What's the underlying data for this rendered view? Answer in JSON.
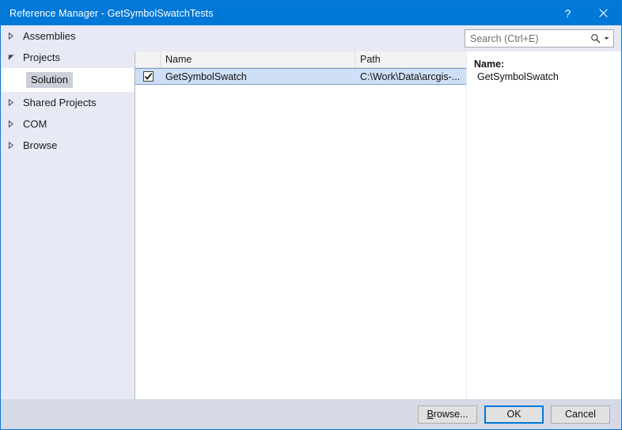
{
  "window": {
    "title": "Reference Manager - GetSymbolSwatchTests",
    "help_button": "?",
    "close_button": "✕",
    "accent_color": "#0078d7",
    "border_color": "#0d7ad4",
    "sidebar_bg": "#e7eaf4",
    "footer_bg": "#d6dae7",
    "selection_bg": "#cfdff7"
  },
  "sidebar": {
    "items": [
      {
        "label": "Assemblies",
        "expanded": false,
        "icon": "chevron-right-icon"
      },
      {
        "label": "Projects",
        "expanded": true,
        "icon": "chevron-down-icon"
      },
      {
        "label": "Shared Projects",
        "expanded": false,
        "icon": "chevron-right-icon"
      },
      {
        "label": "COM",
        "expanded": false,
        "icon": "chevron-right-icon"
      },
      {
        "label": "Browse",
        "expanded": false,
        "icon": "chevron-right-icon"
      }
    ],
    "child": {
      "label": "Solution",
      "selected": true
    }
  },
  "search": {
    "placeholder": "Search (Ctrl+E)",
    "value": "",
    "icon": "search-icon",
    "dropdown_icon": "chevron-down-icon"
  },
  "list": {
    "columns": [
      {
        "key": "check",
        "label": ""
      },
      {
        "key": "name",
        "label": "Name"
      },
      {
        "key": "path",
        "label": "Path"
      }
    ],
    "rows": [
      {
        "checked": true,
        "name": "GetSymbolSwatch",
        "path": "C:\\Work\\Data\\arcgis-...",
        "selected": true
      }
    ]
  },
  "detail": {
    "name_label": "Name:",
    "name_value": "GetSymbolSwatch"
  },
  "footer": {
    "buttons": [
      {
        "label": "Browse...",
        "accel": "B",
        "rest": "rowse...",
        "default": false
      },
      {
        "label": "OK",
        "default": true
      },
      {
        "label": "Cancel",
        "default": false
      }
    ]
  }
}
